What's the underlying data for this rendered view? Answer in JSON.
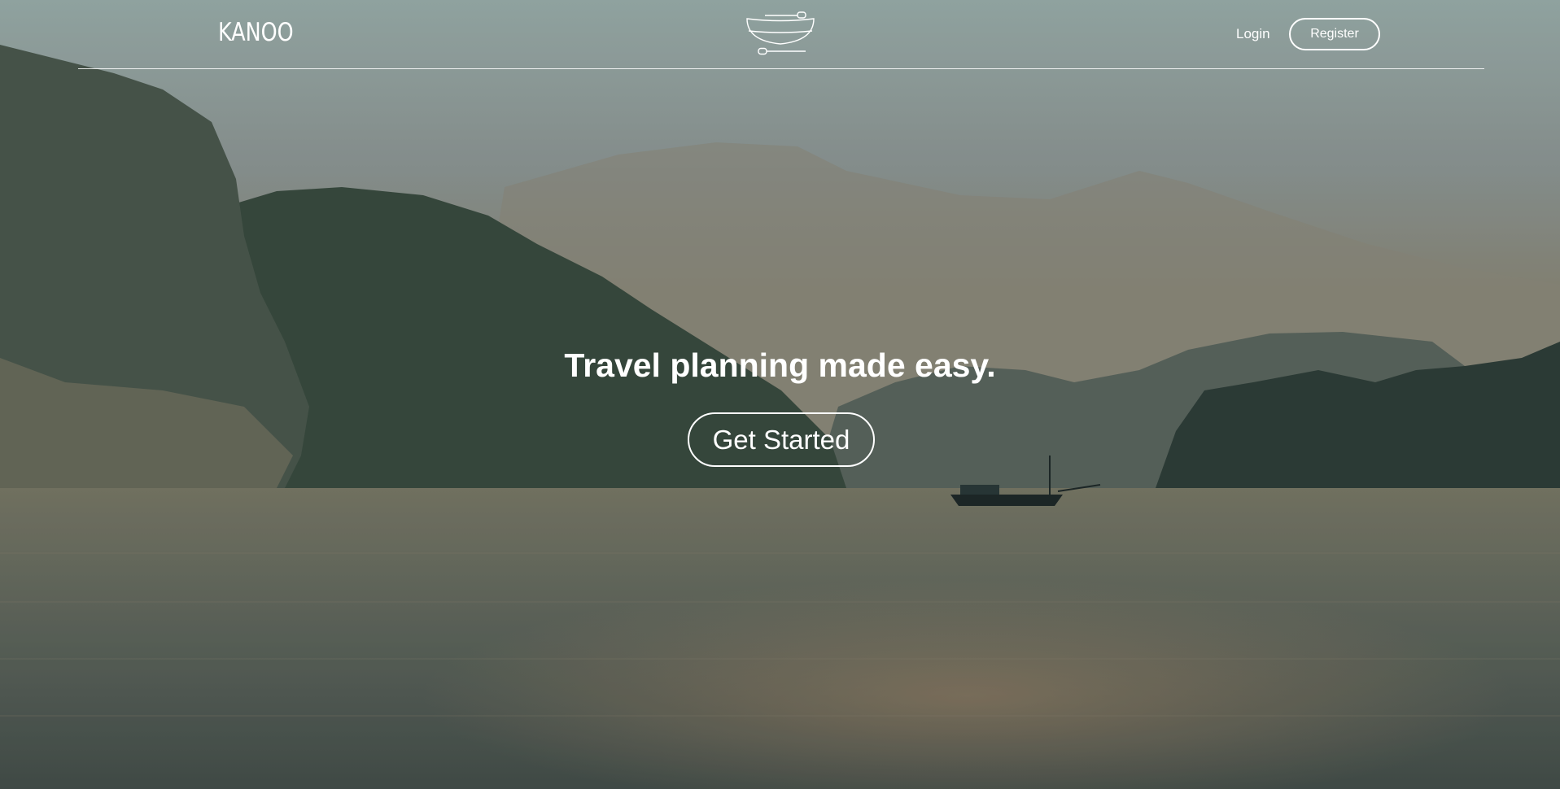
{
  "header": {
    "brand": "KANOO",
    "logo_icon": "canoe-with-paddles-icon",
    "login_label": "Login",
    "register_label": "Register"
  },
  "hero": {
    "title": "Travel planning made easy.",
    "cta_label": "Get Started",
    "background": "misty-bay-with-karst-islands-and-boat"
  },
  "colors": {
    "text": "#ffffff",
    "sky_top": "#9db1ae",
    "water": "#6b6f62"
  }
}
